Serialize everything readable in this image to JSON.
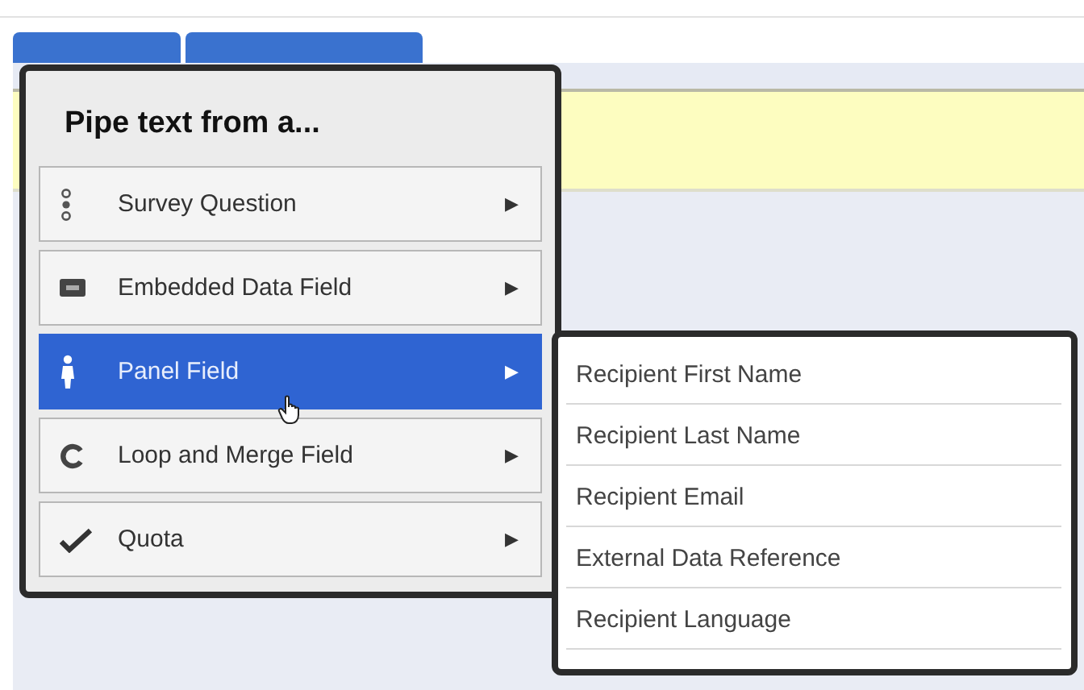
{
  "menu": {
    "title": "Pipe text from a...",
    "items": [
      {
        "kind": "question",
        "label": "Survey Question",
        "selected": false,
        "arrow": "▶"
      },
      {
        "kind": "embedded",
        "label": "Embedded Data Field",
        "selected": false,
        "arrow": "▶"
      },
      {
        "kind": "panel",
        "label": "Panel Field",
        "selected": true,
        "arrow": "▶"
      },
      {
        "kind": "loop",
        "label": "Loop and Merge Field",
        "selected": false,
        "arrow": "▶"
      },
      {
        "kind": "quota",
        "label": "Quota",
        "selected": false,
        "arrow": "▶"
      }
    ]
  },
  "submenu": {
    "items": [
      {
        "label": "Recipient First Name"
      },
      {
        "label": "Recipient Last Name"
      },
      {
        "label": "Recipient Email"
      },
      {
        "label": "External Data Reference"
      },
      {
        "label": "Recipient Language"
      }
    ]
  }
}
